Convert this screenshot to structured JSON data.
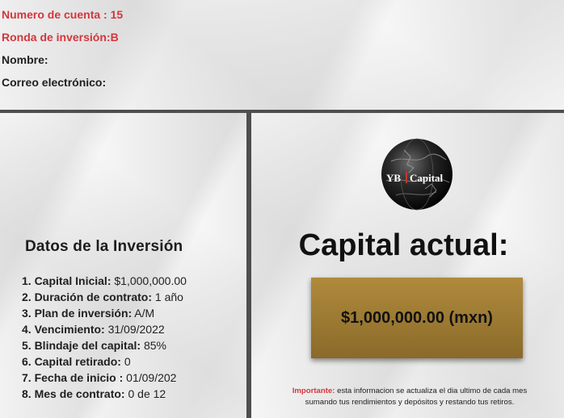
{
  "header": {
    "account": "Numero de cuenta : 15",
    "round": "Ronda de inversión:B",
    "name_label": "Nombre:",
    "email_label": "Correo electrónico:"
  },
  "investment": {
    "title": "Datos de la Inversión",
    "items": [
      {
        "label": "1. Capital Inicial:",
        "value": "$1,000,000.00"
      },
      {
        "label": "2. Duración de contrato:",
        "value": "1 año"
      },
      {
        "label": "3. Plan de inversión:",
        "value": "A/M"
      },
      {
        "label": "4. Vencimiento:",
        "value": "31/09/2022"
      },
      {
        "label": "5. Blindaje del capital:",
        "value": "85%"
      },
      {
        "label": "6. Capital retirado:",
        "value": "0"
      },
      {
        "label": "7. Fecha de inicio :",
        "value": "01/09/202"
      },
      {
        "label": "8. Mes de contrato:",
        "value": "0 de 12"
      }
    ]
  },
  "logo": {
    "brand_left": "YB",
    "brand_right": "Capital"
  },
  "capital": {
    "title": "Capital actual:",
    "amount": "$1,000,000.00 (mxn)"
  },
  "note": {
    "important_label": "Importante:",
    "line1": "esta informacion se actualiza el dia ultimo de cada mes",
    "line2": "sumando tus rendimientos y depósitos y restando tus retiros."
  },
  "colors": {
    "accent_red": "#d3363c",
    "gold": "#a07e35",
    "divider": "#4e4e4e"
  }
}
